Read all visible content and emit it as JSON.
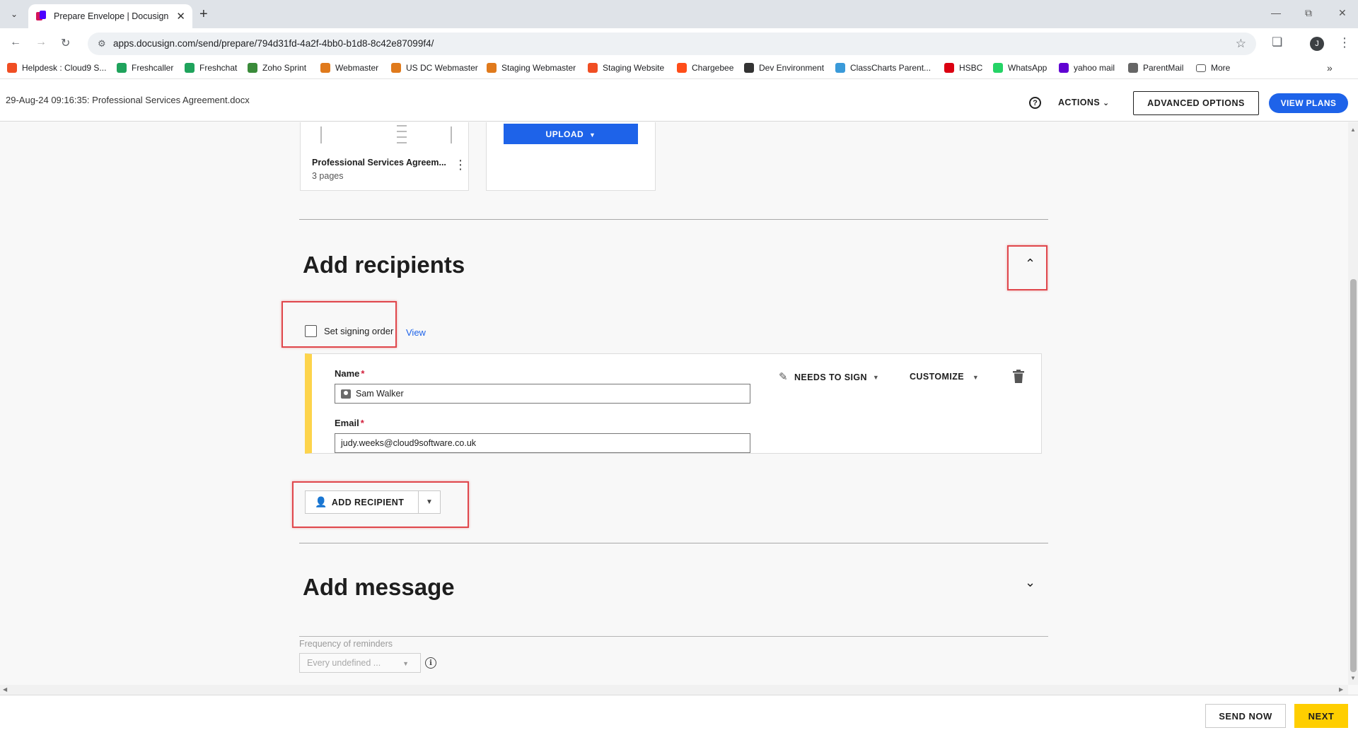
{
  "browser": {
    "tab_title": "Prepare Envelope | Docusign",
    "url": "apps.docusign.com/send/prepare/794d31fd-4a2f-4bb0-b1d8-8c42e87099f4/",
    "profile_initial": "J",
    "bookmarks": [
      {
        "label": "Helpdesk : Cloud9 S...",
        "icon": "c9-icon",
        "color": "#f04e23"
      },
      {
        "label": "Freshcaller",
        "icon": "freshcaller-icon",
        "color": "#1fa35c"
      },
      {
        "label": "Freshchat",
        "icon": "freshchat-icon",
        "color": "#1fa35c"
      },
      {
        "label": "Zoho Sprint",
        "icon": "zoho-sprint-icon",
        "color": "#3a8b3a"
      },
      {
        "label": "Webmaster",
        "icon": "webmaster-icon",
        "color": "#e07a1c"
      },
      {
        "label": "US DC Webmaster",
        "icon": "webmaster-icon",
        "color": "#e07a1c"
      },
      {
        "label": "Staging Webmaster",
        "icon": "webmaster-icon",
        "color": "#e07a1c"
      },
      {
        "label": "Staging Website",
        "icon": "staging-icon",
        "color": "#f04e23"
      },
      {
        "label": "Chargebee",
        "icon": "chargebee-icon",
        "color": "#ff4d19"
      },
      {
        "label": "Dev Environment",
        "icon": "gauge-icon",
        "color": "#333333"
      },
      {
        "label": "ClassCharts Parent...",
        "icon": "classcharts-icon",
        "color": "#3a9ad9"
      },
      {
        "label": "HSBC",
        "icon": "hsbc-icon",
        "color": "#db0011"
      },
      {
        "label": "WhatsApp",
        "icon": "whatsapp-icon",
        "color": "#25d366"
      },
      {
        "label": "yahoo mail",
        "icon": "yahoo-mail-icon",
        "color": "#6001d2"
      },
      {
        "label": "ParentMail",
        "icon": "parentmail-icon",
        "color": "#666666"
      },
      {
        "label": "More",
        "icon": "folder-icon",
        "color": "#555555"
      }
    ]
  },
  "header": {
    "doc_title": "29-Aug-24 09:16:35: Professional Services Agreement.docx",
    "actions_label": "ACTIONS",
    "advanced_label": "ADVANCED OPTIONS",
    "plans_label": "VIEW PLANS"
  },
  "documents": {
    "name": "Professional Services Agreem...",
    "pages": "3 pages",
    "upload_label": "UPLOAD"
  },
  "recipients": {
    "title": "Add recipients",
    "signing_order_label": "Set signing order",
    "view_link": "View",
    "name_label": "Name",
    "name_value": "Sam Walker",
    "email_label": "Email",
    "email_value": "judy.weeks@cloud9software.co.uk",
    "required_mark": "*",
    "role_label": "NEEDS TO SIGN",
    "customize_label": "CUSTOMIZE",
    "add_label": "ADD RECIPIENT",
    "card_accent": "#fdd44c"
  },
  "message": {
    "title": "Add message",
    "frequency_label": "Frequency of reminders",
    "frequency_value": "Every undefined ..."
  },
  "footer": {
    "send_now_label": "SEND NOW",
    "next_label": "NEXT"
  },
  "colors": {
    "primary": "#1e63e9",
    "next": "#ffce00",
    "highlight": "#e0474c"
  }
}
